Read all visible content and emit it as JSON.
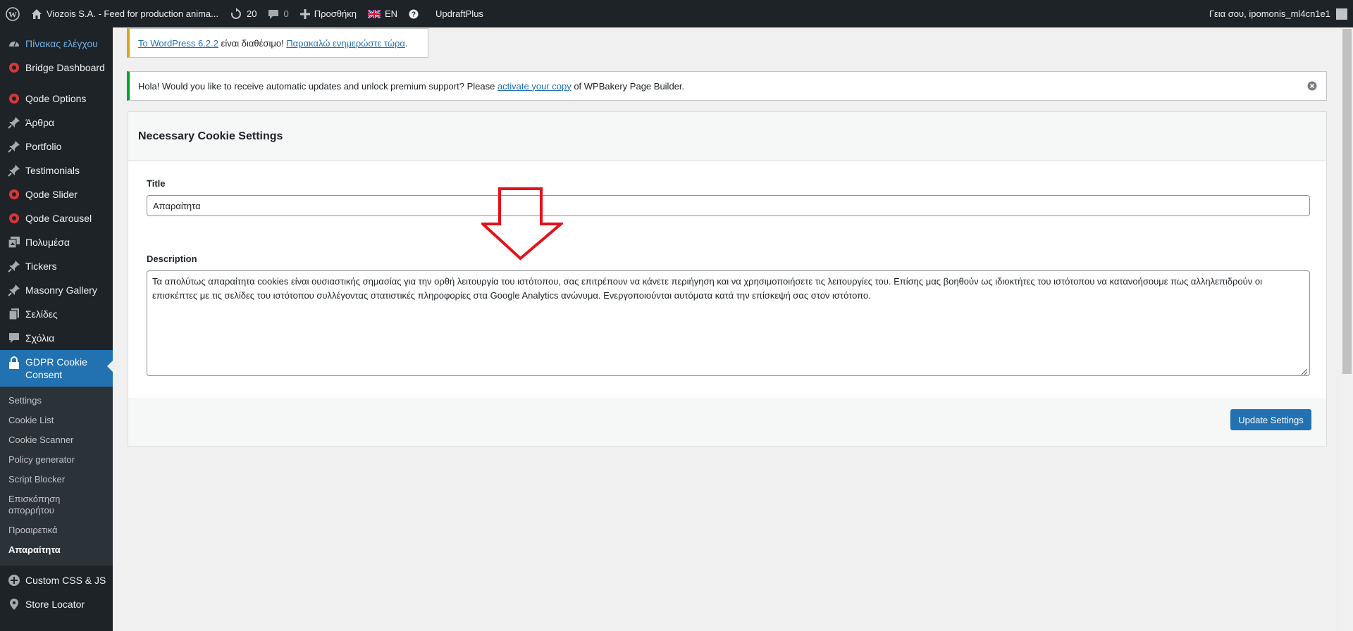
{
  "adminbar": {
    "site_name": "Viozois S.A. - Feed for production anima...",
    "updates_count": "20",
    "comments_count": "0",
    "new_label": "Προσθήκη",
    "lang_label": "EN",
    "updraft_label": "UpdraftPlus",
    "greeting": "Γεια σου, ipomonis_ml4cn1e1"
  },
  "sidebar": {
    "dashboard": "Πίνακας ελέγχου",
    "bridge_dashboard": "Bridge Dashboard",
    "items": [
      {
        "label": "Qode Options",
        "icon": "qode-icon"
      },
      {
        "label": "Άρθρα",
        "icon": "pin-icon"
      },
      {
        "label": "Portfolio",
        "icon": "pin-icon"
      },
      {
        "label": "Testimonials",
        "icon": "pin-icon"
      },
      {
        "label": "Qode Slider",
        "icon": "qode-icon"
      },
      {
        "label": "Qode Carousel",
        "icon": "qode-icon"
      },
      {
        "label": "Πολυμέσα",
        "icon": "media-icon"
      },
      {
        "label": "Tickers",
        "icon": "pin-icon"
      },
      {
        "label": "Masonry Gallery",
        "icon": "pin-icon"
      },
      {
        "label": "Σελίδες",
        "icon": "page-icon"
      },
      {
        "label": "Σχόλια",
        "icon": "comment-icon"
      }
    ],
    "current": "GDPR Cookie Consent",
    "submenu": [
      "Settings",
      "Cookie List",
      "Cookie Scanner",
      "Policy generator",
      "Script Blocker",
      "Επισκόπηση απορρήτου",
      "Προαιρετικά",
      "Απαραίτητα"
    ],
    "after": [
      {
        "label": "Custom CSS & JS",
        "icon": "plus-circle-icon"
      },
      {
        "label": "Store Locator",
        "icon": "location-icon"
      }
    ]
  },
  "notices": {
    "wp_link1": "Το WordPress 6.2.2",
    "wp_text": " είναι διαθέσιμο! ",
    "wp_link2": "Παρακαλώ ενημερώστε τώρα",
    "wp_end": ".",
    "vc_text1": "Hola! Would you like to receive automatic updates and unlock premium support? Please ",
    "vc_link": "activate your copy",
    "vc_text2": " of WPBakery Page Builder."
  },
  "panel": {
    "heading": "Necessary Cookie Settings",
    "title_label": "Title",
    "title_value": "Απαραίτητα",
    "description_label": "Description",
    "description_value": "Τα απολύτως απαραίτητα cookies είναι ουσιαστικής σημασίας για την ορθή λειτουργία του ιστότοπου, σας επιτρέπουν να κάνετε περιήγηση και να χρησιμοποιήσετε τις λειτουργίες του. Επίσης μας βοηθούν ως ιδιοκτήτες του ιστότοπου να κατανοήσουμε πως αλληλεπιδρούν οι επισκέπτες με τις σελίδες του ιστότοπου συλλέγοντας στατιστικές πληροφορίες στα Google Analytics ανώνυμα. Ενεργοποιούνται αυτόματα κατά την επίσκεψή σας στον ιστότοπο.",
    "update_button": "Update Settings"
  },
  "colors": {
    "adminbar_bg": "#1d2327",
    "accent": "#2271b1",
    "annotation_arrow": "#e3121b"
  }
}
